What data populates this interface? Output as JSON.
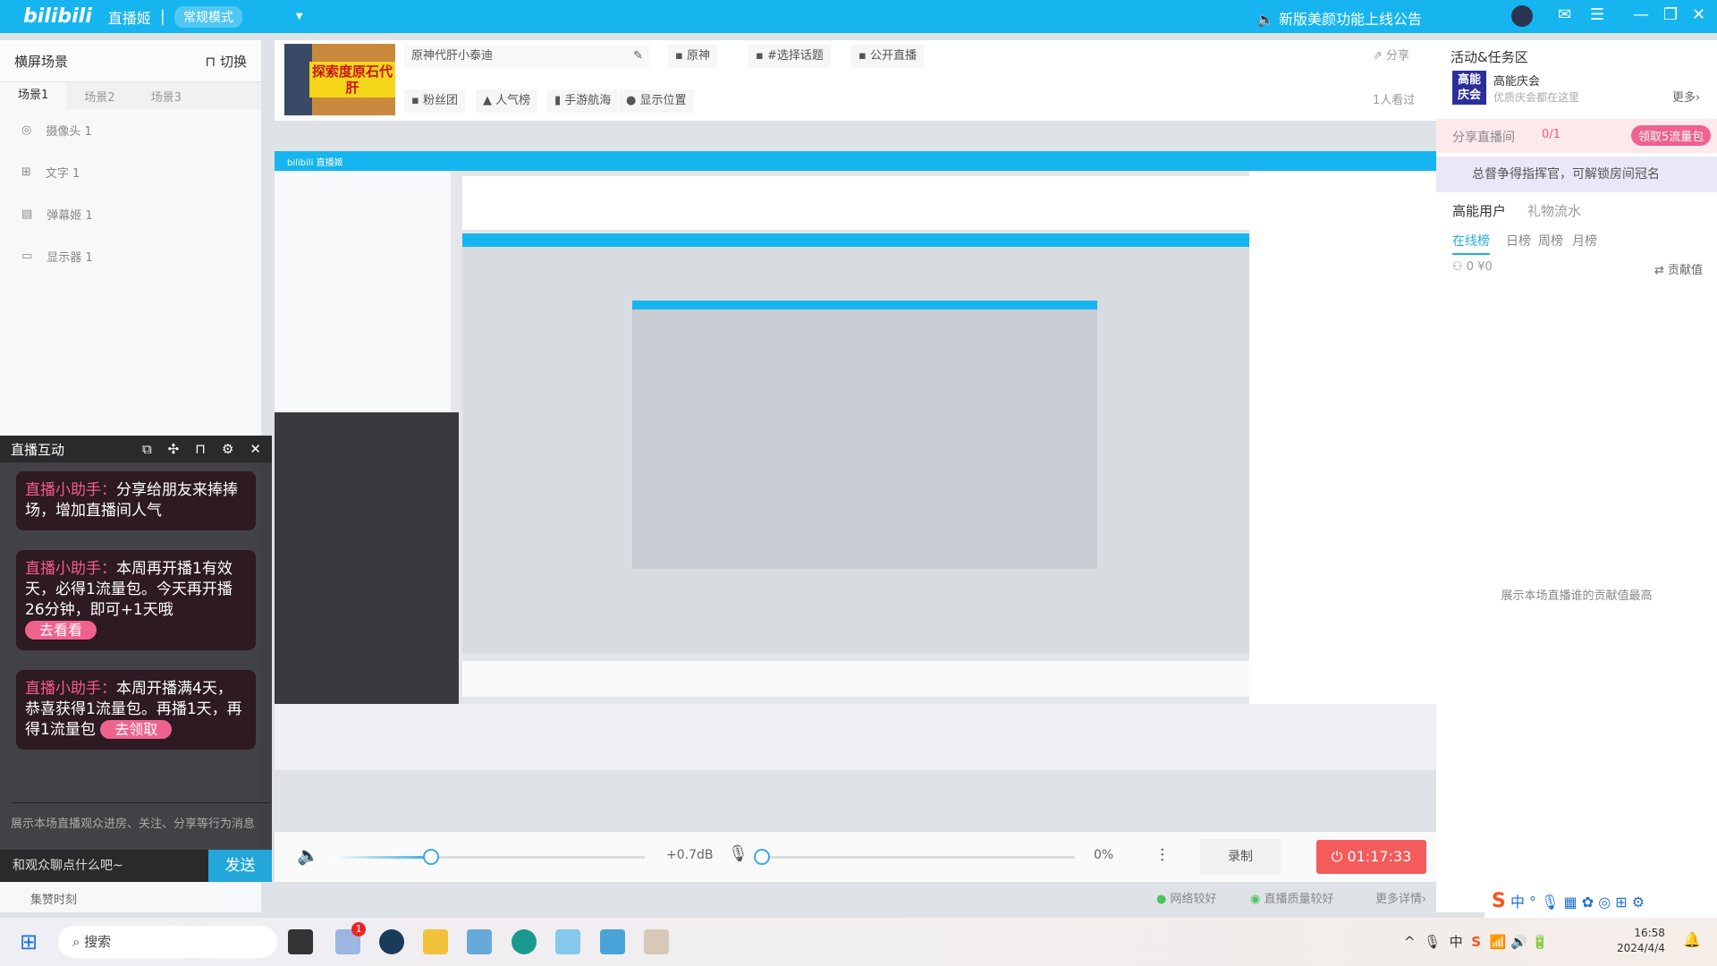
{
  "titlebar": {
    "logo": "bilibili",
    "app": "直播姬",
    "mode": "常规模式",
    "notice": "新版美颜功能上线公告"
  },
  "scene": {
    "title": "横屏场景",
    "switch": "切换",
    "tabs": [
      "场景1",
      "场景2",
      "场景3"
    ],
    "sources": [
      {
        "icon": "camera-icon",
        "label": "摄像头 1"
      },
      {
        "icon": "text-icon",
        "label": "文字 1"
      },
      {
        "icon": "danmaku-icon",
        "label": "弹幕姬 1"
      },
      {
        "icon": "monitor-icon",
        "label": "显示器 1"
      }
    ],
    "bottom_label": "集赞时刻"
  },
  "info": {
    "cover_text": "探索度原石代肝",
    "room_title": "原神代肝小泰迪",
    "category": "原神",
    "topic": "#选择话题",
    "public": "公开直播",
    "share": "分享",
    "fans": "粉丝团",
    "popular": "人气榜",
    "voyage": "手游航海",
    "location": "显示位置",
    "viewed": "1人看过"
  },
  "right": {
    "activity_title": "活动&任务区",
    "banner_badge": "高能庆会",
    "banner_title": "高能庆会",
    "banner_sub": "优质庆会都在这里",
    "more": "更多",
    "share_task": "分享直播间",
    "share_progress": "0/1",
    "claim": "领取5流量包",
    "commander": "总督争得指挥官，可解锁房间冠名",
    "tabs": [
      "高能用户",
      "礼物流水"
    ],
    "rank_tabs": [
      "在线榜",
      "日榜",
      "周榜",
      "月榜"
    ],
    "counts": "0  ¥0",
    "contrib": "贡献值",
    "empty": "展示本场直播谁的贡献值最高"
  },
  "interact": {
    "title": "直播互动",
    "messages": [
      {
        "who": "直播小助手：",
        "text": "分享给朋友来捧捧场，增加直播间人气",
        "btn": ""
      },
      {
        "who": "直播小助手：",
        "text": "本周再开播1有效天，必得1流量包。今天再开播26分钟，即可+1天哦",
        "btn": "去看看"
      },
      {
        "who": "直播小助手：",
        "text": "本周开播满4天，恭喜获得1流量包。再播1天，再得1流量包",
        "btn": "去领取"
      }
    ],
    "hint": "展示本场直播观众进房、关注、分享等行为消息",
    "placeholder": "和观众聊点什么吧~",
    "send": "发送"
  },
  "controls": {
    "volume_db": "+0.7dB",
    "volume_level": 0.32,
    "mic_pct": "0%",
    "mic_level": 0,
    "record": "录制",
    "timer": "01:17:33",
    "network": "网络较好",
    "quality": "直播质量较好",
    "details": "更多详情"
  },
  "taskbar": {
    "search": "搜索",
    "badge": "1",
    "time": "16:58",
    "date": "2024/4/4"
  },
  "colors": {
    "brand": "#17b5ef",
    "live": "#f45b5b",
    "pink": "#f0628e"
  }
}
